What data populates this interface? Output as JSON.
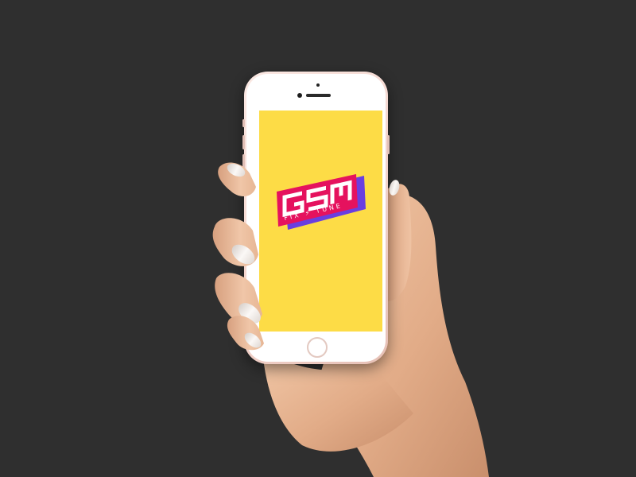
{
  "background_color": "#2f2f2f",
  "screen": {
    "background_color": "#fddc46",
    "logo": {
      "brand": "GSM",
      "tagline": "FIX ⚡ TUNE",
      "colors": {
        "primary": "#e5125e",
        "shadow": "#6a3ee0",
        "text": "#ffffff"
      }
    }
  },
  "phone": {
    "color": "rose-gold"
  },
  "hand": {
    "skin_tone": "#e8b796",
    "nail_color": "#f2ece8"
  }
}
